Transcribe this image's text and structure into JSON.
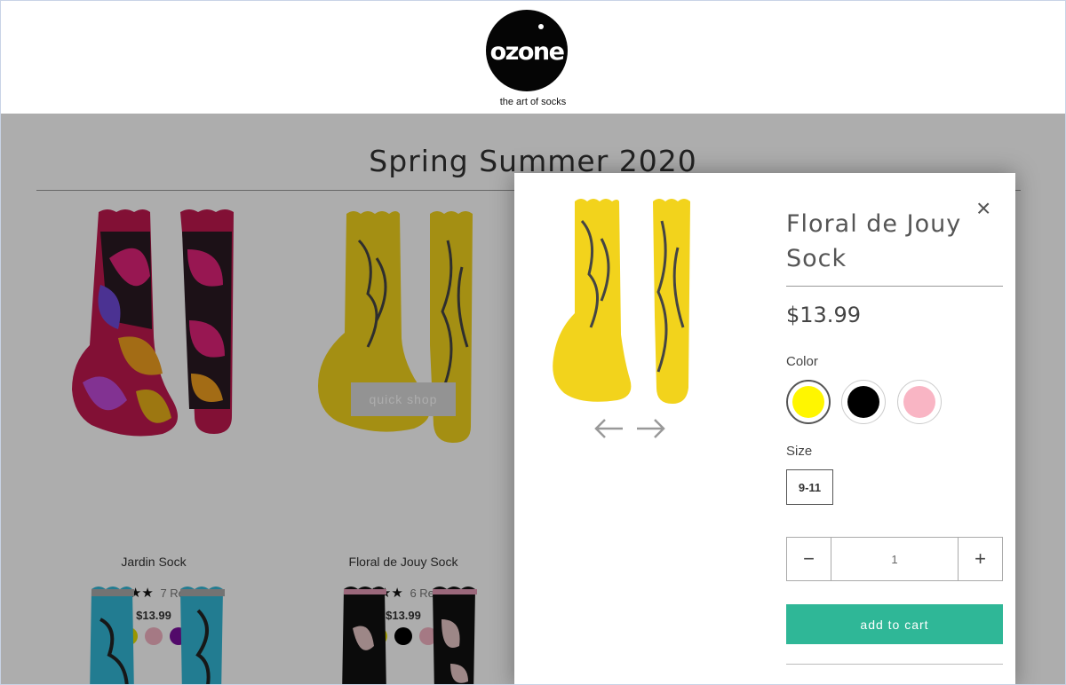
{
  "brand": {
    "logo_text": "ozone",
    "tagline": "the art of socks"
  },
  "collection": {
    "title": "Spring Summer 2020"
  },
  "products": [
    {
      "name": "Jardin Sock",
      "stars": "★★★★★",
      "reviews": "7 Reviews",
      "price": "$13.99",
      "swatches": [
        "#e3dd00",
        "#f3b3c3",
        "#7a0f9c"
      ]
    },
    {
      "name": "Floral de Jouy Sock",
      "stars": "★★★★★",
      "reviews": "6 Reviews",
      "price": "$13.99",
      "swatches": [
        "#e3dd00",
        "#000000",
        "#f3b3c3"
      ],
      "quick_shop_label": "quick shop"
    }
  ],
  "modal": {
    "title": "Floral de Jouy Sock",
    "price": "$13.99",
    "color_label": "Color",
    "colors": [
      "yellow",
      "black",
      "pink"
    ],
    "color_hex": [
      "#fff600",
      "#000000",
      "#f9b5c4"
    ],
    "size_label": "Size",
    "size_value": "9-11",
    "quantity_value": "1",
    "minus_symbol": "−",
    "plus_symbol": "+",
    "close_symbol": "×",
    "add_to_cart_label": "add to cart"
  },
  "colors": {
    "accent": "#2fb797",
    "overlay": "rgba(0,0,0,0.32)"
  }
}
